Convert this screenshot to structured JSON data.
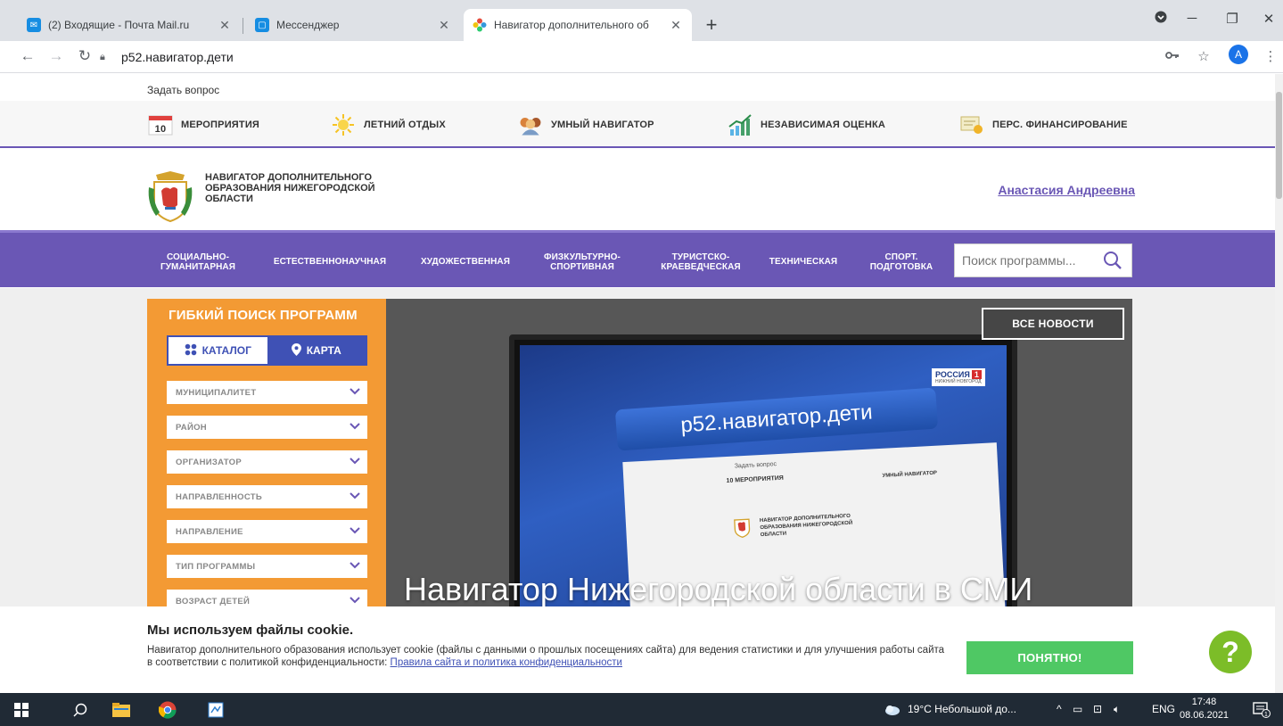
{
  "browser": {
    "tabs": [
      {
        "title": "(2) Входящие - Почта Mail.ru",
        "active": false
      },
      {
        "title": "Мессенджер",
        "active": false
      },
      {
        "title": "Навигатор дополнительного об",
        "active": true
      }
    ],
    "url": "p52.навигатор.дети",
    "avatar_letter": "A"
  },
  "page": {
    "ask_question": "Задать вопрос",
    "top_menu": [
      {
        "label": "МЕРОПРИЯТИЯ",
        "icon": "calendar-icon",
        "badge": "10"
      },
      {
        "label": "ЛЕТНИЙ ОТДЫХ",
        "icon": "sun-icon"
      },
      {
        "label": "УМНЫЙ НАВИГАТОР",
        "icon": "people-icon"
      },
      {
        "label": "НЕЗАВИСИМАЯ ОЦЕНКА",
        "icon": "chart-icon"
      },
      {
        "label": "ПЕРС. ФИНАНСИРОВАНИЕ",
        "icon": "certificate-icon"
      }
    ],
    "brand": "НАВИГАТОР ДОПОЛНИТЕЛЬНОГО ОБРАЗОВАНИЯ НИЖЕГОРОДСКОЙ ОБЛАСТИ",
    "user_name": "Анастасия Андреевна",
    "categories": [
      "СОЦИАЛЬНО-ГУМАНИТАРНАЯ",
      "ЕСТЕСТВЕННОНАУЧНАЯ",
      "ХУДОЖЕСТВЕННАЯ",
      "ФИЗКУЛЬТУРНО-СПОРТИВНАЯ",
      "ТУРИСТСКО-КРАЕВЕДЧЕСКАЯ",
      "ТЕХНИЧЕСКАЯ",
      "СПОРТ. ПОДГОТОВКА"
    ],
    "search_placeholder": "Поиск программы...",
    "filter": {
      "title": "ГИБКИЙ ПОИСК ПРОГРАММ",
      "tab_catalog": "КАТАЛОГ",
      "tab_map": "КАРТА",
      "selects": [
        "МУНИЦИПАЛИТЕТ",
        "РАЙОН",
        "ОРГАНИЗАТОР",
        "НАПРАВЛЕННОСТЬ",
        "НАПРАВЛЕНИЕ",
        "ТИП ПРОГРАММЫ",
        "ВОЗРАСТ ДЕТЕЙ"
      ]
    },
    "slider": {
      "all_news": "ВСЕ НОВОСТИ",
      "title": "Навигатор Нижегородской области в СМИ",
      "tv_url": "p52.навигатор.дети",
      "tv_channel": "РОССИЯ",
      "tv_channel_num": "1",
      "tv_region": "НИЖНИЙ НОВГОРОД",
      "tv_ask": "Задать вопрос",
      "tv_menu_1": "10  МЕРОПРИЯТИЯ",
      "tv_menu_2": "УМНЫЙ НАВИГАТОР",
      "tv_brand": "НАВИГАТОР ДОПОЛНИТЕЛЬНОГО ОБРАЗОВАНИЯ НИЖЕГОРОДСКОЙ ОБЛАСТИ"
    },
    "cookie": {
      "title": "Мы используем файлы cookie.",
      "text": "Навигатор дополнительного образования использует cookie (файлы с данными о прошлых посещениях сайта) для ведения статистики и для улучшения работы сайта в соответствии с политикой конфиденциальности: ",
      "link": "Правила сайта и политика конфиденциальности",
      "button": "ПОНЯТНО!"
    }
  },
  "taskbar": {
    "weather": "19°C  Небольшой до...",
    "lang": "ENG",
    "time": "17:48",
    "date": "08.06.2021",
    "notification_count": "1"
  }
}
